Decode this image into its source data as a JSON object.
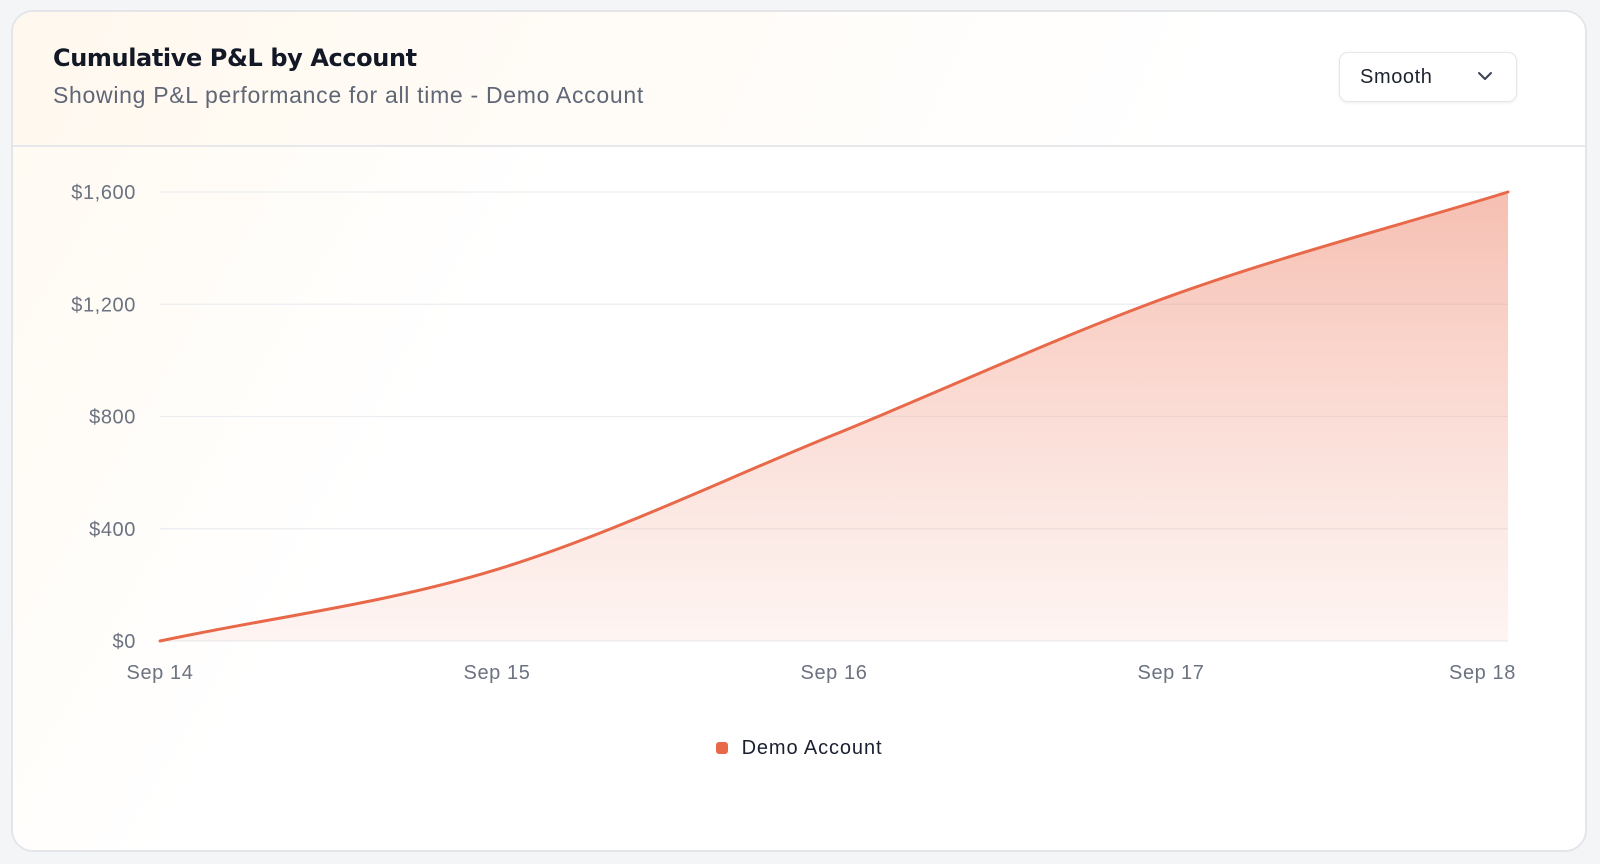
{
  "header": {
    "title": "Cumulative P&L by Account",
    "subtitle": "Showing P&L performance for all time - Demo Account"
  },
  "curve_select": {
    "selected": "Smooth",
    "icon": "chevron-down-icon"
  },
  "colors": {
    "series": "#e8694a",
    "grid": "#ebedf0",
    "axis_text": "#6b7280"
  },
  "chart_data": {
    "type": "area",
    "title": "Cumulative P&L by Account",
    "subtitle": "Showing P&L performance for all time - Demo Account",
    "x": [
      "Sep 14",
      "Sep 15",
      "Sep 16",
      "Sep 17",
      "Sep 18"
    ],
    "series": [
      {
        "name": "Demo Account",
        "values": [
          0,
          255,
          735,
          1230,
          1600
        ]
      }
    ],
    "yticks": [
      "$0",
      "$400",
      "$800",
      "$1,200",
      "$1,600"
    ],
    "ylim": [
      0,
      1600
    ],
    "curve": "smooth",
    "grid": true,
    "legend": "bottom-center"
  }
}
